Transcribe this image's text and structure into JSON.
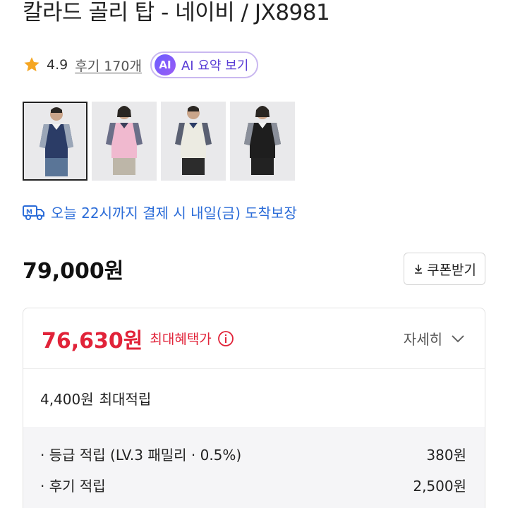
{
  "product": {
    "title": "칼라드 골리 탑 - 네이비 / JX8981"
  },
  "rating": {
    "value": "4.9",
    "reviews_link": "후기 170개",
    "ai_badge": "AI",
    "ai_summary_label": "AI 요약 보기",
    "star_color": "#f5a623"
  },
  "gallery": {
    "thumbnails": [
      {
        "color": "navy",
        "selected": true
      },
      {
        "color": "pink",
        "selected": false
      },
      {
        "color": "cream",
        "selected": false
      },
      {
        "color": "black",
        "selected": false
      }
    ]
  },
  "delivery": {
    "text": "오늘 22시까지 결제 시 내일(금) 도착보장",
    "color": "#2b6cd8"
  },
  "price": {
    "original": "79,000원",
    "coupon_label": "쿠폰받기"
  },
  "benefit": {
    "max_price": "76,630원",
    "max_price_label": "최대혜택가",
    "detail_label": "자세히",
    "max_points": "4,400원",
    "max_points_label": "최대적립",
    "accent_color": "#e12339",
    "breakdown": [
      {
        "label": "· 등급 적립 (LV.3 패밀리 · 0.5%)",
        "value": "380원"
      },
      {
        "label": "· 후기 적립",
        "value": "2,500원"
      },
      {
        "label": "",
        "value": ""
      }
    ]
  }
}
